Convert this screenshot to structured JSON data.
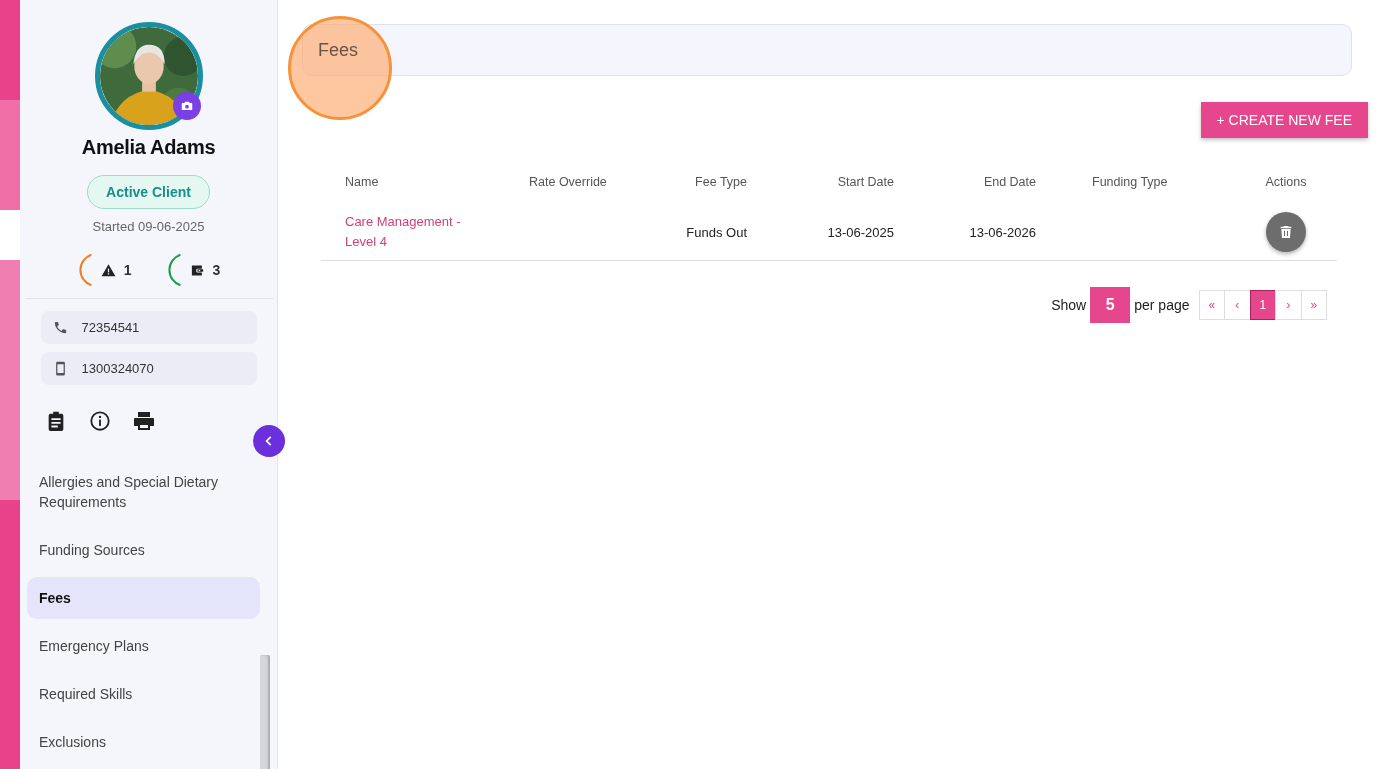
{
  "sidebar": {
    "client_name": "Amelia Adams",
    "status": "Active Client",
    "started": "Started 09-06-2025",
    "stats": [
      {
        "kind": "alert",
        "count": "1",
        "color": "#f07d22"
      },
      {
        "kind": "wallet",
        "count": "3",
        "color": "#1e9b4b"
      }
    ],
    "contacts": [
      {
        "kind": "phone",
        "number": "72354541"
      },
      {
        "kind": "mobile",
        "number": "1300324070"
      }
    ],
    "nav_items": [
      {
        "label": "Allergies and Special Dietary Requirements",
        "selected": false
      },
      {
        "label": "Funding Sources",
        "selected": false
      },
      {
        "label": "Fees",
        "selected": true
      },
      {
        "label": "Emergency Plans",
        "selected": false
      },
      {
        "label": "Required Skills",
        "selected": false
      },
      {
        "label": "Exclusions",
        "selected": false
      }
    ]
  },
  "page_title": "Fees",
  "create_button": "+ CREATE NEW FEE",
  "table": {
    "columns": [
      "Name",
      "Rate Override",
      "Fee Type",
      "Start Date",
      "End Date",
      "Funding Type",
      "Actions"
    ],
    "rows": [
      {
        "name": "Care Management - Level 4",
        "rate_override": "",
        "fee_type": "Funds Out",
        "start_date": "13-06-2025",
        "end_date": "13-06-2026",
        "funding_type": ""
      }
    ]
  },
  "pagination": {
    "show_label": "Show",
    "per_page": "5",
    "per_page_label": "per page",
    "pages": [
      {
        "label": "«",
        "selected": false
      },
      {
        "label": "‹",
        "selected": false
      },
      {
        "label": "1",
        "selected": true
      },
      {
        "label": "›",
        "selected": false
      },
      {
        "label": "»",
        "selected": false
      }
    ]
  }
}
